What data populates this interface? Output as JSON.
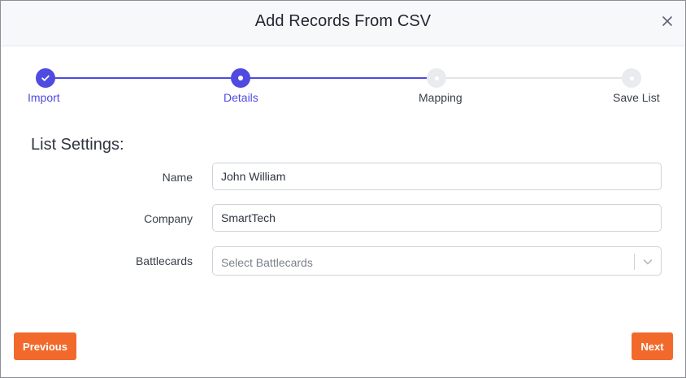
{
  "modal": {
    "title": "Add Records From CSV",
    "close_icon": "close-icon"
  },
  "stepper": {
    "steps": [
      {
        "label": "Import",
        "state": "done"
      },
      {
        "label": "Details",
        "state": "current"
      },
      {
        "label": "Mapping",
        "state": "todo"
      },
      {
        "label": "Save List",
        "state": "todo"
      }
    ],
    "accent_color": "#4f4be0"
  },
  "form": {
    "section_title": "List Settings:",
    "name": {
      "label": "Name",
      "value": "John William"
    },
    "company": {
      "label": "Company",
      "value": "SmartTech"
    },
    "battlecards": {
      "label": "Battlecards",
      "placeholder": "Select Battlecards",
      "icon": "chevron-down-icon"
    }
  },
  "footer": {
    "previous_label": "Previous",
    "next_label": "Next",
    "button_color": "#f26a2b"
  }
}
